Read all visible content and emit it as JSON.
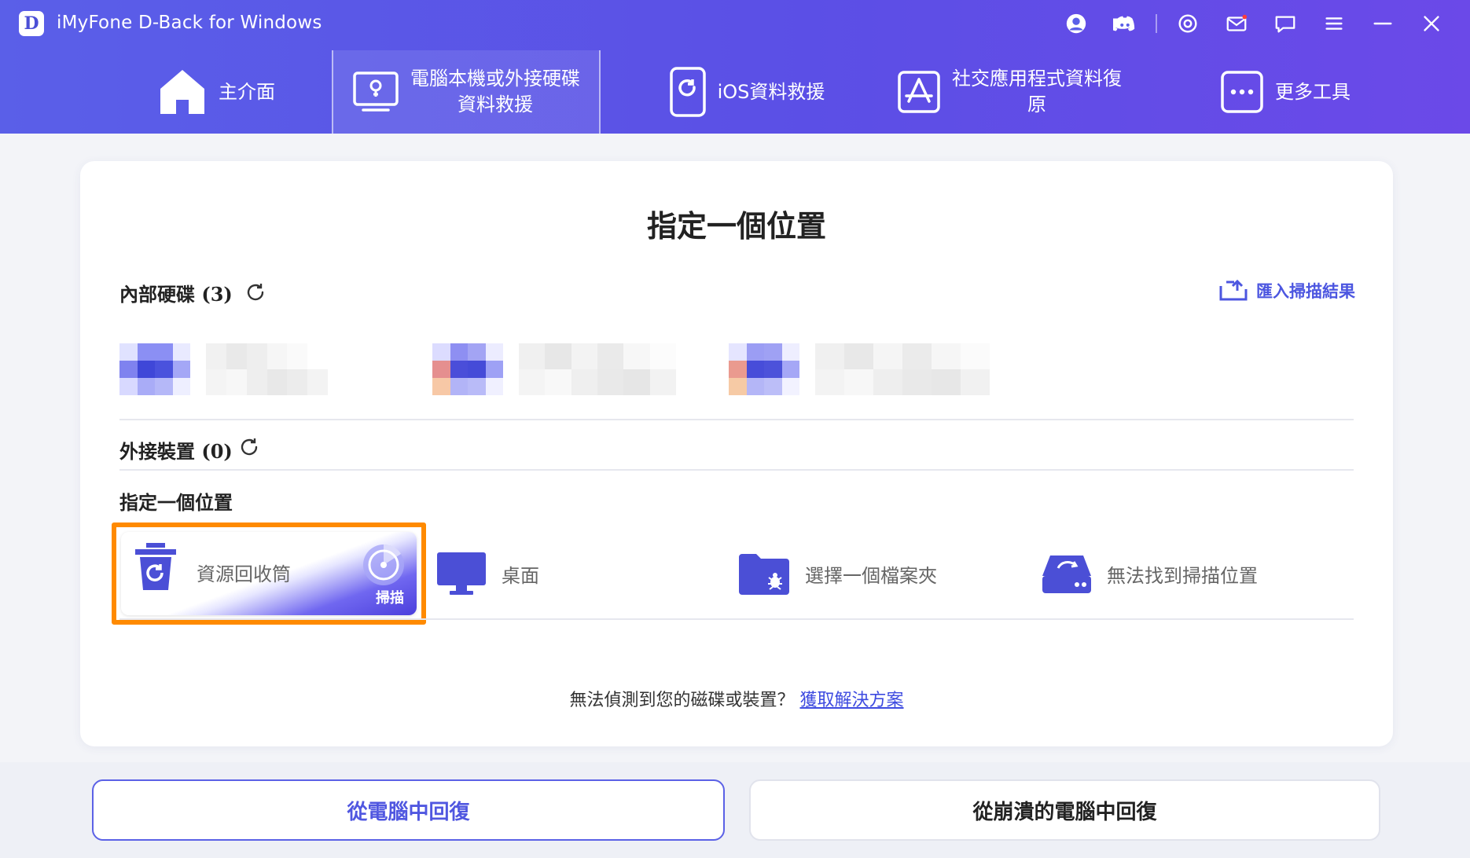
{
  "app": {
    "logo_letter": "D",
    "title": "iMyFone D-Back for Windows"
  },
  "titlebar_icons": [
    "account-icon",
    "discord-icon",
    "settings-icon",
    "mail-icon",
    "feedback-icon",
    "menu-icon",
    "minimize-icon",
    "close-icon"
  ],
  "nav": {
    "items": [
      {
        "label": "主介面",
        "icon": "home-icon"
      },
      {
        "label_line1": "電腦本機或外接硬碟",
        "label_line2": "資料救援",
        "icon": "drive-recovery-icon",
        "active": true
      },
      {
        "label": "iOS資料救援",
        "icon": "ios-recovery-icon"
      },
      {
        "label_line1": "社交應用程式資料復",
        "label_line2": "原",
        "icon": "app-store-icon"
      },
      {
        "label": "更多工具",
        "icon": "more-tools-icon"
      }
    ]
  },
  "main": {
    "title": "指定一個位置",
    "internal_disks_label": "內部硬碟 (3)",
    "import_label": "匯入掃描結果",
    "external_devices_label": "外接裝置 (0)",
    "specify_location_label": "指定一個位置",
    "locations": [
      {
        "label": "資源回收筒",
        "icon": "recycle-bin-icon",
        "badge": "掃描",
        "selected": true
      },
      {
        "label": "桌面",
        "icon": "desktop-icon"
      },
      {
        "label": "選擇一個檔案夾",
        "icon": "folder-icon"
      },
      {
        "label": "無法找到掃描位置",
        "icon": "lost-drive-icon"
      }
    ],
    "helper_text": "無法偵測到您的磁碟或裝置？",
    "helper_link": "獲取解決方案"
  },
  "bottom": {
    "recover_from_pc": "從電腦中回復",
    "recover_from_crashed": "從崩潰的電腦中回復"
  },
  "colors": {
    "header_start": "#5a5fe8",
    "header_end": "#6b49e8",
    "accent": "#5057e0",
    "highlight": "#ff8a00"
  }
}
